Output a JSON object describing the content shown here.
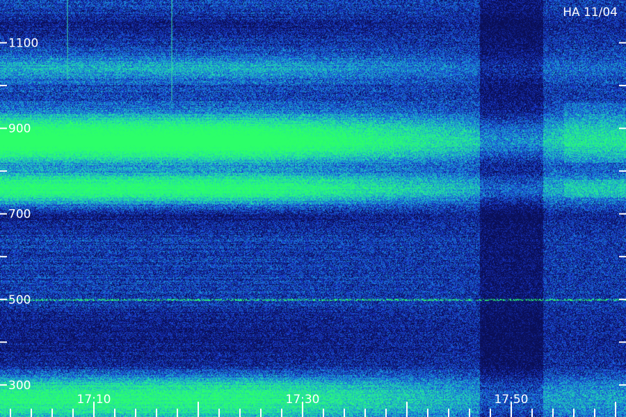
{
  "chart_data": {
    "type": "heatmap",
    "title": "HA 11/04",
    "xlabel": "",
    "ylabel": "",
    "y_ticks": [
      {
        "label": "1100",
        "value": 1100
      },
      {
        "label": "900",
        "value": 900
      },
      {
        "label": "700",
        "value": 700
      },
      {
        "label": "500",
        "value": 500
      },
      {
        "label": "300",
        "value": 300
      }
    ],
    "ylim": [
      225,
      1200
    ],
    "x_ticks": [
      {
        "label": "17:10",
        "minutes": 10
      },
      {
        "label": "17:30",
        "minutes": 30
      },
      {
        "label": "17:50",
        "minutes": 50
      }
    ],
    "xlim": [
      "17:01",
      "17:61"
    ],
    "colormap": [
      "#0a0f57",
      "#1a3bd6",
      "#1a9bd6",
      "#23e0a8",
      "#2cff6a"
    ],
    "bands": [
      {
        "freq_center": 1040,
        "freq_width": 30,
        "intensity": 0.35
      },
      {
        "freq_center": 900,
        "freq_width": 45,
        "intensity": 0.55
      },
      {
        "freq_center": 860,
        "freq_width": 40,
        "intensity": 0.78
      },
      {
        "freq_center": 760,
        "freq_width": 35,
        "intensity": 0.85
      },
      {
        "freq_center": 270,
        "freq_width": 55,
        "intensity": 0.75
      }
    ],
    "dark_gaps": [
      {
        "freq_center": 1140,
        "freq_width": 25
      },
      {
        "freq_center": 690,
        "freq_width": 30
      },
      {
        "freq_center": 430,
        "freq_width": 50
      },
      {
        "freq_center": 350,
        "freq_width": 40
      }
    ],
    "interference_lines": [
      {
        "freq": 500
      }
    ],
    "dark_interval": {
      "start": "17:47",
      "end": "17:53"
    }
  }
}
